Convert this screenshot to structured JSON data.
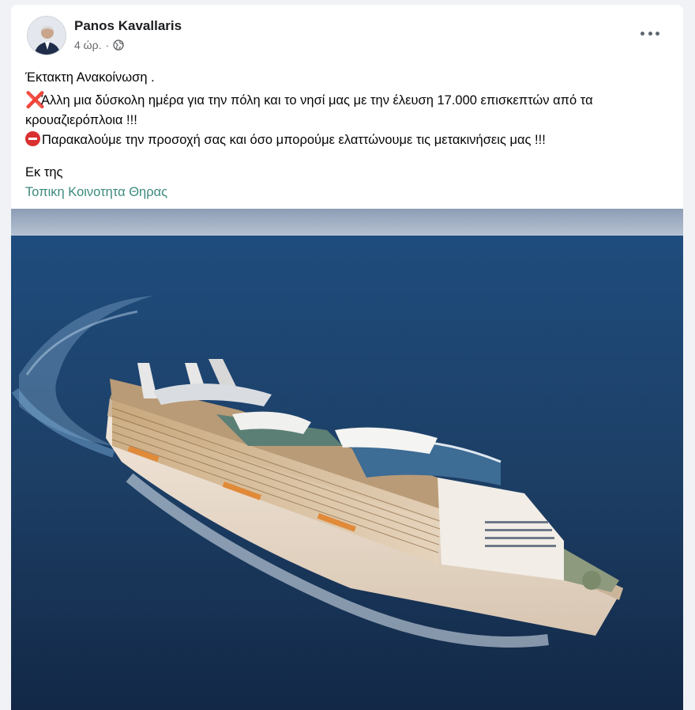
{
  "post": {
    "author": "Panos Kavallaris",
    "time": "4 ώρ.",
    "separator": "·",
    "audience_icon": "globe-icon",
    "more_icon": "more-options-icon",
    "lines": {
      "title": "Έκτακτη Ανακοίνωση .",
      "announcement_line1": "Άλλη μια δύσκολη ημέρα για την πόλη και το νησί μας με την έλευση 17.000 επισκεπτών από τα",
      "announcement_line2": "κρουαζιερόπλοια !!!",
      "request": "Παρακαλούμε την προσοχή σας και όσο μπορούμε ελαττώνουμε τις μετακινήσεις μας !!!",
      "from_label": "Εκ της",
      "source_link": "Τοπικη Κοινοτητα Θηρας"
    },
    "emoji": {
      "cross": "❌",
      "no_entry": "no-entry-icon"
    },
    "photo": {
      "subject": "cruise-ship-photo"
    }
  },
  "colors": {
    "background": "#f0f2f5",
    "card": "#ffffff",
    "link": "#3b8a7f",
    "meta": "#65676b",
    "sea": "#1d3f66"
  }
}
